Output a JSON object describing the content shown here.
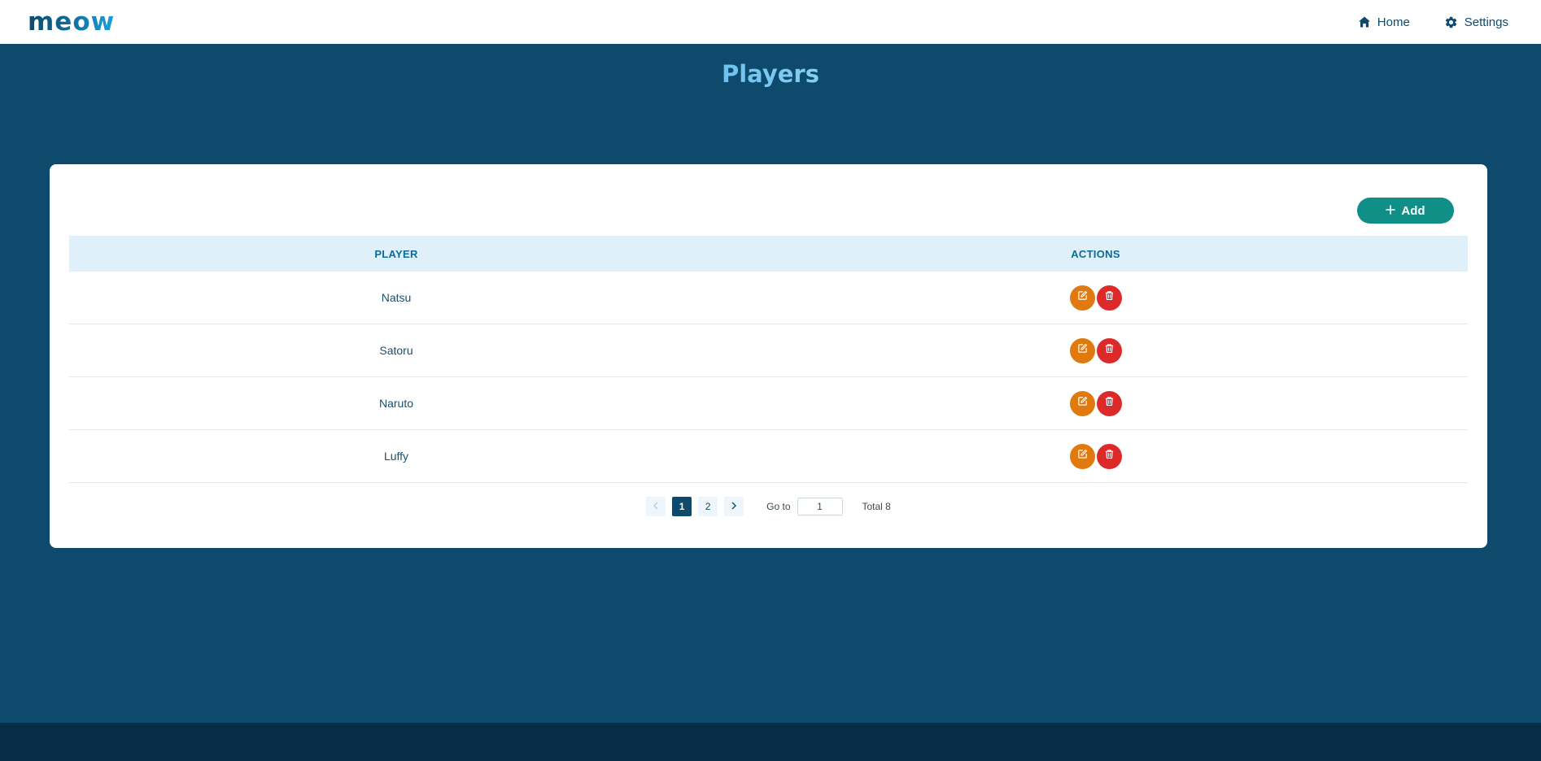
{
  "app": {
    "logo": "meow"
  },
  "nav": {
    "home_icon": "home-icon",
    "home_label": "Home",
    "settings_icon": "gear-icon",
    "settings_label": "Settings"
  },
  "page": {
    "title": "Players"
  },
  "toolbar": {
    "add_label": "Add",
    "add_icon": "plus-icon"
  },
  "table": {
    "headers": [
      "PLAYER",
      "ACTIONS"
    ],
    "rows": [
      {
        "player": "Natsu"
      },
      {
        "player": "Satoru"
      },
      {
        "player": "Naruto"
      },
      {
        "player": "Luffy"
      }
    ],
    "row_actions": [
      "edit-icon",
      "trash-icon"
    ]
  },
  "pagination": {
    "pages": [
      "1",
      "2"
    ],
    "current_page": "1",
    "goto_label": "Go to",
    "goto_value": "1",
    "total_label": "Total 8"
  },
  "colors": {
    "brand": "#0d4a6b",
    "header_bg": "#ffffff",
    "add_button": "#108f87",
    "edit_button": "#e07a0e",
    "delete_button": "#dc2a2a",
    "table_header_bg": "#dff0fb",
    "footer": "#082d46"
  }
}
